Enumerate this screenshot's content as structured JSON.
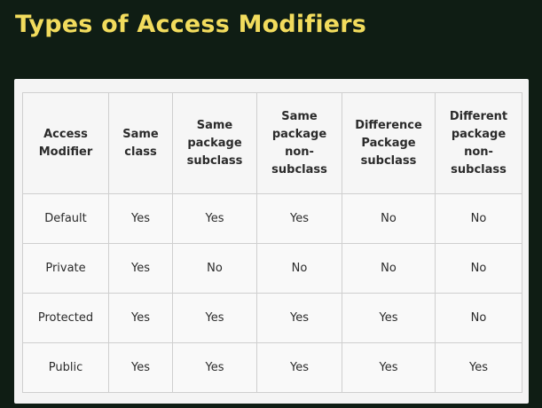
{
  "title": "Types of Access Modifiers",
  "table": {
    "headers": [
      [
        "Access",
        "Modifier"
      ],
      [
        "Same",
        "class"
      ],
      [
        "Same",
        "package",
        "subclass"
      ],
      [
        "Same",
        "package",
        "non-",
        "subclass"
      ],
      [
        "Difference",
        "Package",
        "subclass"
      ],
      [
        "Different",
        "package",
        "non-",
        "subclass"
      ]
    ],
    "rows": [
      [
        "Default",
        "Yes",
        "Yes",
        "Yes",
        "No",
        "No"
      ],
      [
        "Private",
        "Yes",
        "No",
        "No",
        "No",
        "No"
      ],
      [
        "Protected",
        "Yes",
        "Yes",
        "Yes",
        "Yes",
        "No"
      ],
      [
        "Public",
        "Yes",
        "Yes",
        "Yes",
        "Yes",
        "Yes"
      ]
    ]
  },
  "colors": {
    "background": "#0f1d14",
    "title": "#f2dc5d",
    "card": "#f4f4f4",
    "grid": "#cfcfcf",
    "text": "#2b2b2b"
  }
}
